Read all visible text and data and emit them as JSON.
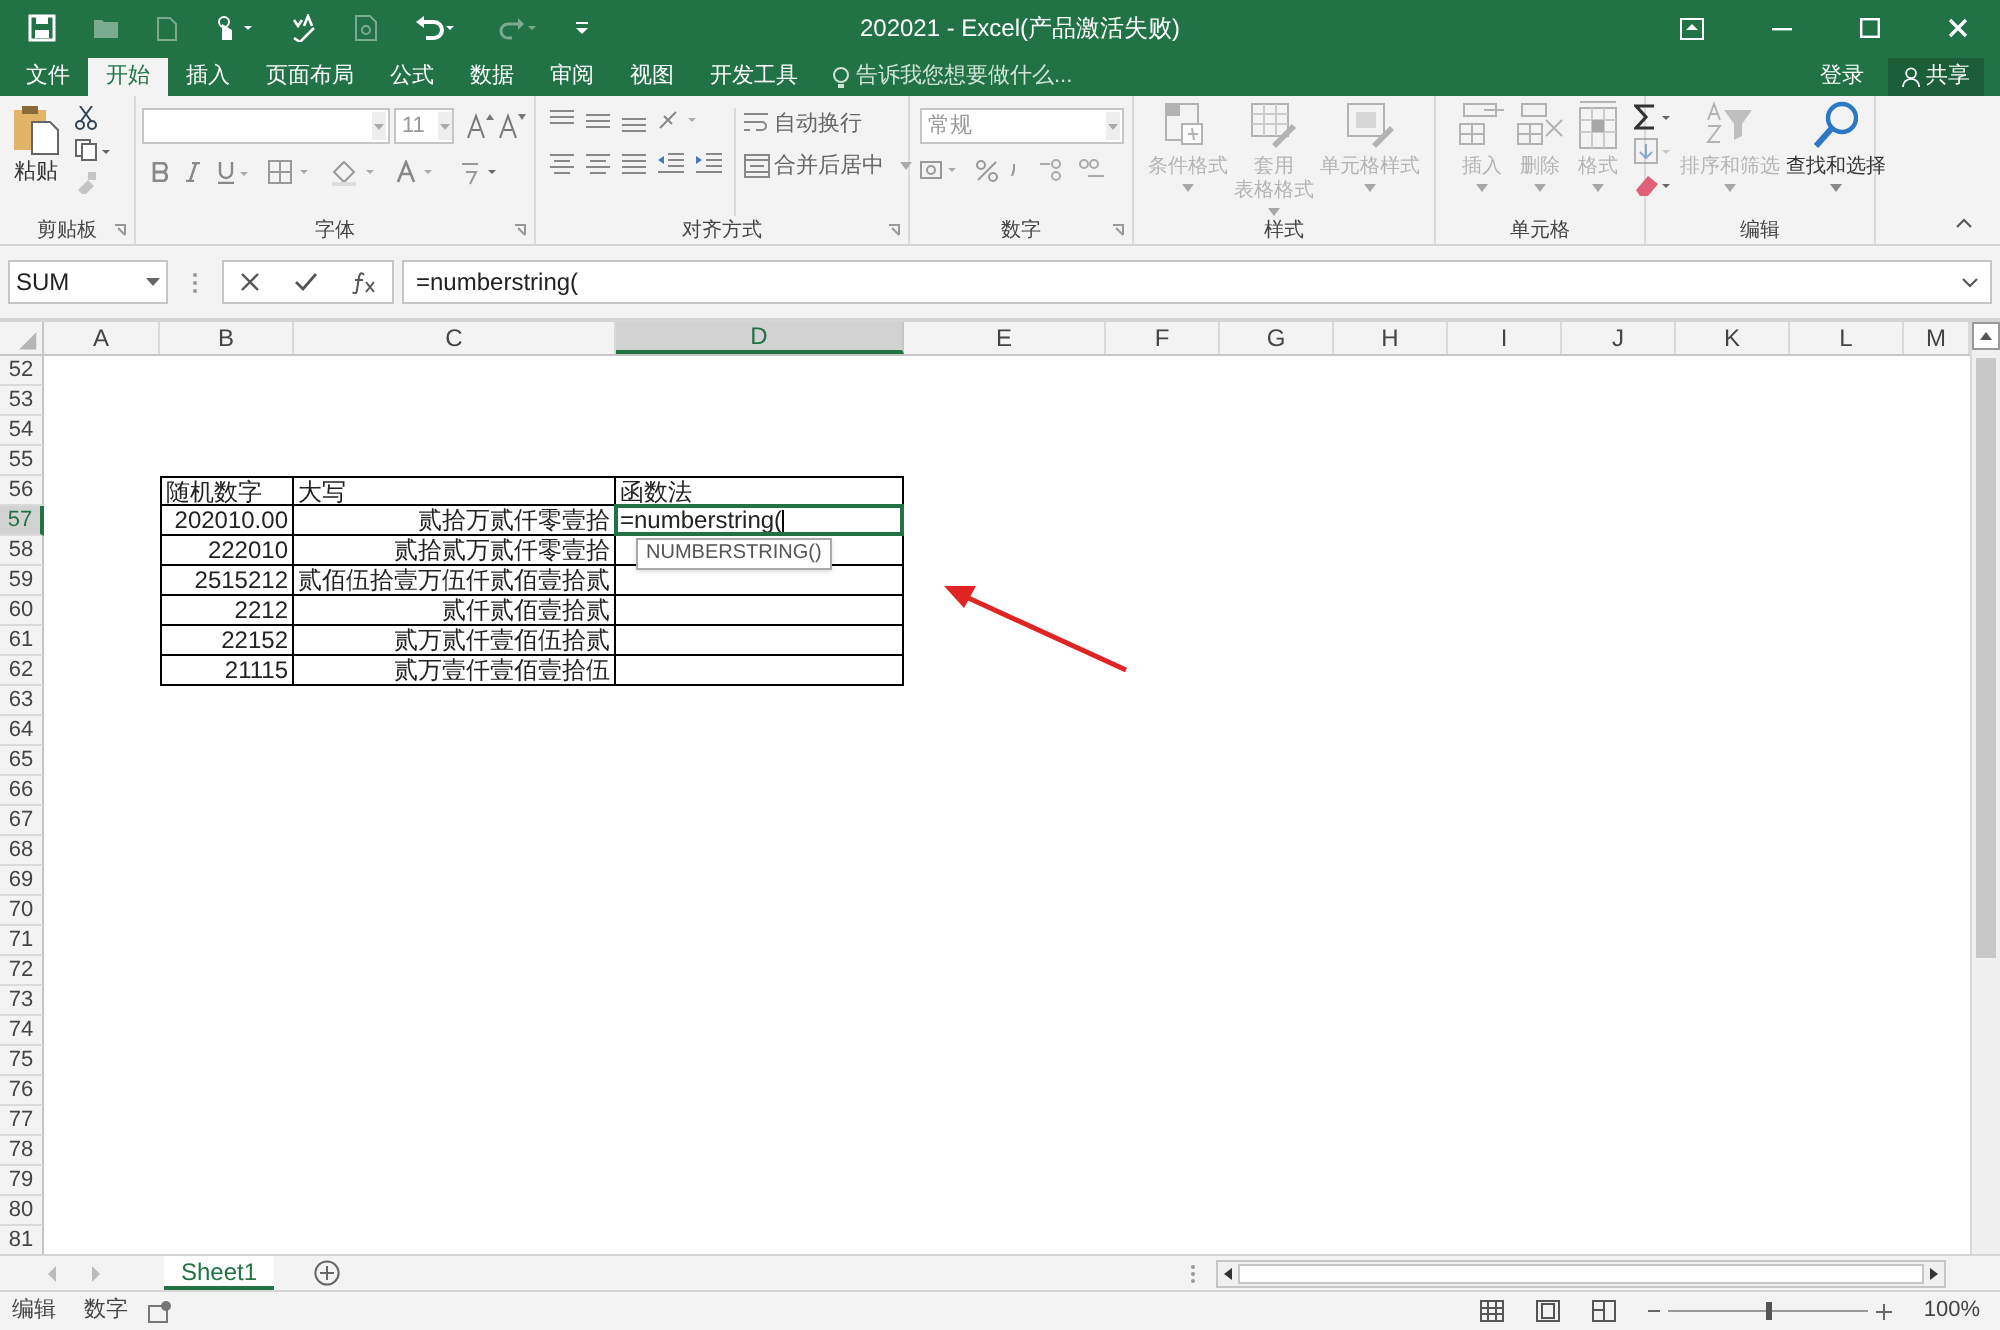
{
  "title_bar": {
    "title": "202021 - Excel(产品激活失败)"
  },
  "menu_tabs": [
    {
      "label": "文件",
      "selected": false
    },
    {
      "label": "开始",
      "selected": true
    },
    {
      "label": "插入",
      "selected": false
    },
    {
      "label": "页面布局",
      "selected": false
    },
    {
      "label": "公式",
      "selected": false
    },
    {
      "label": "数据",
      "selected": false
    },
    {
      "label": "审阅",
      "selected": false
    },
    {
      "label": "视图",
      "selected": false
    },
    {
      "label": "开发工具",
      "selected": false
    }
  ],
  "tell_me": {
    "placeholder": "告诉我您想要做什么..."
  },
  "account": {
    "sign_in": "登录",
    "share": "共享"
  },
  "ribbon": {
    "clipboard": {
      "paste": "粘贴",
      "label": "剪贴板"
    },
    "font": {
      "size": "11",
      "label": "字体"
    },
    "alignment": {
      "wrap": "自动换行",
      "merge": "合并后居中",
      "label": "对齐方式"
    },
    "number": {
      "format": "常规",
      "label": "数字"
    },
    "styles": {
      "buttons": [
        {
          "label": "条件格式",
          "disabled": true
        },
        {
          "label_lines": [
            "套用",
            "表格格式"
          ],
          "disabled": true
        },
        {
          "label": "单元格样式",
          "disabled": true
        }
      ],
      "label": "样式"
    },
    "cells": {
      "buttons": [
        {
          "label": "插入",
          "disabled": true
        },
        {
          "label": "删除",
          "disabled": true
        },
        {
          "label": "格式",
          "disabled": true
        }
      ],
      "label": "单元格"
    },
    "editing": {
      "buttons": [
        {
          "label": "排序和筛选",
          "disabled": true
        },
        {
          "label": "查找和选择",
          "disabled": false
        }
      ],
      "label": "编辑"
    }
  },
  "formula_bar": {
    "name_box": "SUM",
    "formula": "=numberstring("
  },
  "sheet": {
    "columns": [
      {
        "label": "A",
        "selected": false
      },
      {
        "label": "B",
        "selected": false
      },
      {
        "label": "C",
        "selected": false
      },
      {
        "label": "D",
        "selected": true
      },
      {
        "label": "E",
        "selected": false
      },
      {
        "label": "F",
        "selected": false
      },
      {
        "label": "G",
        "selected": false
      },
      {
        "label": "H",
        "selected": false
      },
      {
        "label": "I",
        "selected": false
      },
      {
        "label": "J",
        "selected": false
      },
      {
        "label": "K",
        "selected": false
      },
      {
        "label": "L",
        "selected": false
      },
      {
        "label": "M",
        "selected": false
      }
    ],
    "rows": [
      {
        "number": "52",
        "selected": false
      },
      {
        "number": "53",
        "selected": false
      },
      {
        "number": "54",
        "selected": false
      },
      {
        "number": "55",
        "selected": false
      },
      {
        "number": "56",
        "selected": false,
        "boxed": true,
        "cells": [
          {
            "text": "随机数字",
            "align_right": false
          },
          {
            "text": "大写",
            "align_right": false
          },
          {
            "text": "函数法",
            "align_right": false
          }
        ]
      },
      {
        "number": "57",
        "selected": true,
        "boxed": true,
        "cells": [
          {
            "text": "202010.00",
            "align_right": true
          },
          {
            "text": "贰拾万贰仟零壹拾",
            "align_right": true
          },
          {
            "text": "=numberstring(",
            "align_right": false,
            "editing": true,
            "tooltip": "NUMBERSTRING()"
          }
        ]
      },
      {
        "number": "58",
        "selected": false,
        "boxed": true,
        "cells": [
          {
            "text": "222010",
            "align_right": true
          },
          {
            "text": "贰拾贰万贰仟零壹拾",
            "align_right": true
          }
        ]
      },
      {
        "number": "59",
        "selected": false,
        "boxed": true,
        "cells": [
          {
            "text": "2515212",
            "align_right": true
          },
          {
            "text": "贰佰伍拾壹万伍仟贰佰壹拾贰"
          }
        ]
      },
      {
        "number": "60",
        "selected": false,
        "boxed": true,
        "cells": [
          {
            "text": "2212",
            "align_right": true
          },
          {
            "text": "贰仟贰佰壹拾贰",
            "align_right": true
          }
        ]
      },
      {
        "number": "61",
        "selected": false,
        "boxed": true,
        "cells": [
          {
            "text": "22152",
            "align_right": true
          },
          {
            "text": "贰万贰仟壹佰伍拾贰",
            "align_right": true
          }
        ]
      },
      {
        "number": "62",
        "selected": false,
        "boxed": true,
        "cells": [
          {
            "text": "21115",
            "align_right": true
          },
          {
            "text": "贰万壹仟壹佰壹拾伍",
            "align_right": true
          }
        ]
      },
      {
        "number": "63",
        "selected": false
      },
      {
        "number": "64",
        "selected": false
      },
      {
        "number": "65",
        "selected": false
      },
      {
        "number": "66",
        "selected": false
      },
      {
        "number": "67",
        "selected": false
      },
      {
        "number": "68",
        "selected": false
      },
      {
        "number": "69",
        "selected": false
      },
      {
        "number": "70",
        "selected": false
      },
      {
        "number": "71",
        "selected": false
      },
      {
        "number": "72",
        "selected": false
      },
      {
        "number": "73",
        "selected": false
      },
      {
        "number": "74",
        "selected": false
      },
      {
        "number": "75",
        "selected": false
      },
      {
        "number": "76",
        "selected": false
      },
      {
        "number": "77",
        "selected": false
      },
      {
        "number": "78",
        "selected": false
      },
      {
        "number": "79",
        "selected": false
      },
      {
        "number": "80",
        "selected": false
      },
      {
        "number": "81",
        "selected": false
      }
    ]
  },
  "sheet_tabs": [
    {
      "label": "Sheet1",
      "selected": true
    }
  ],
  "status_bar": {
    "mode": "编辑",
    "num_lock": "数字",
    "zoom": "100%",
    "zoom_level": {
      "level": 0.5
    }
  }
}
